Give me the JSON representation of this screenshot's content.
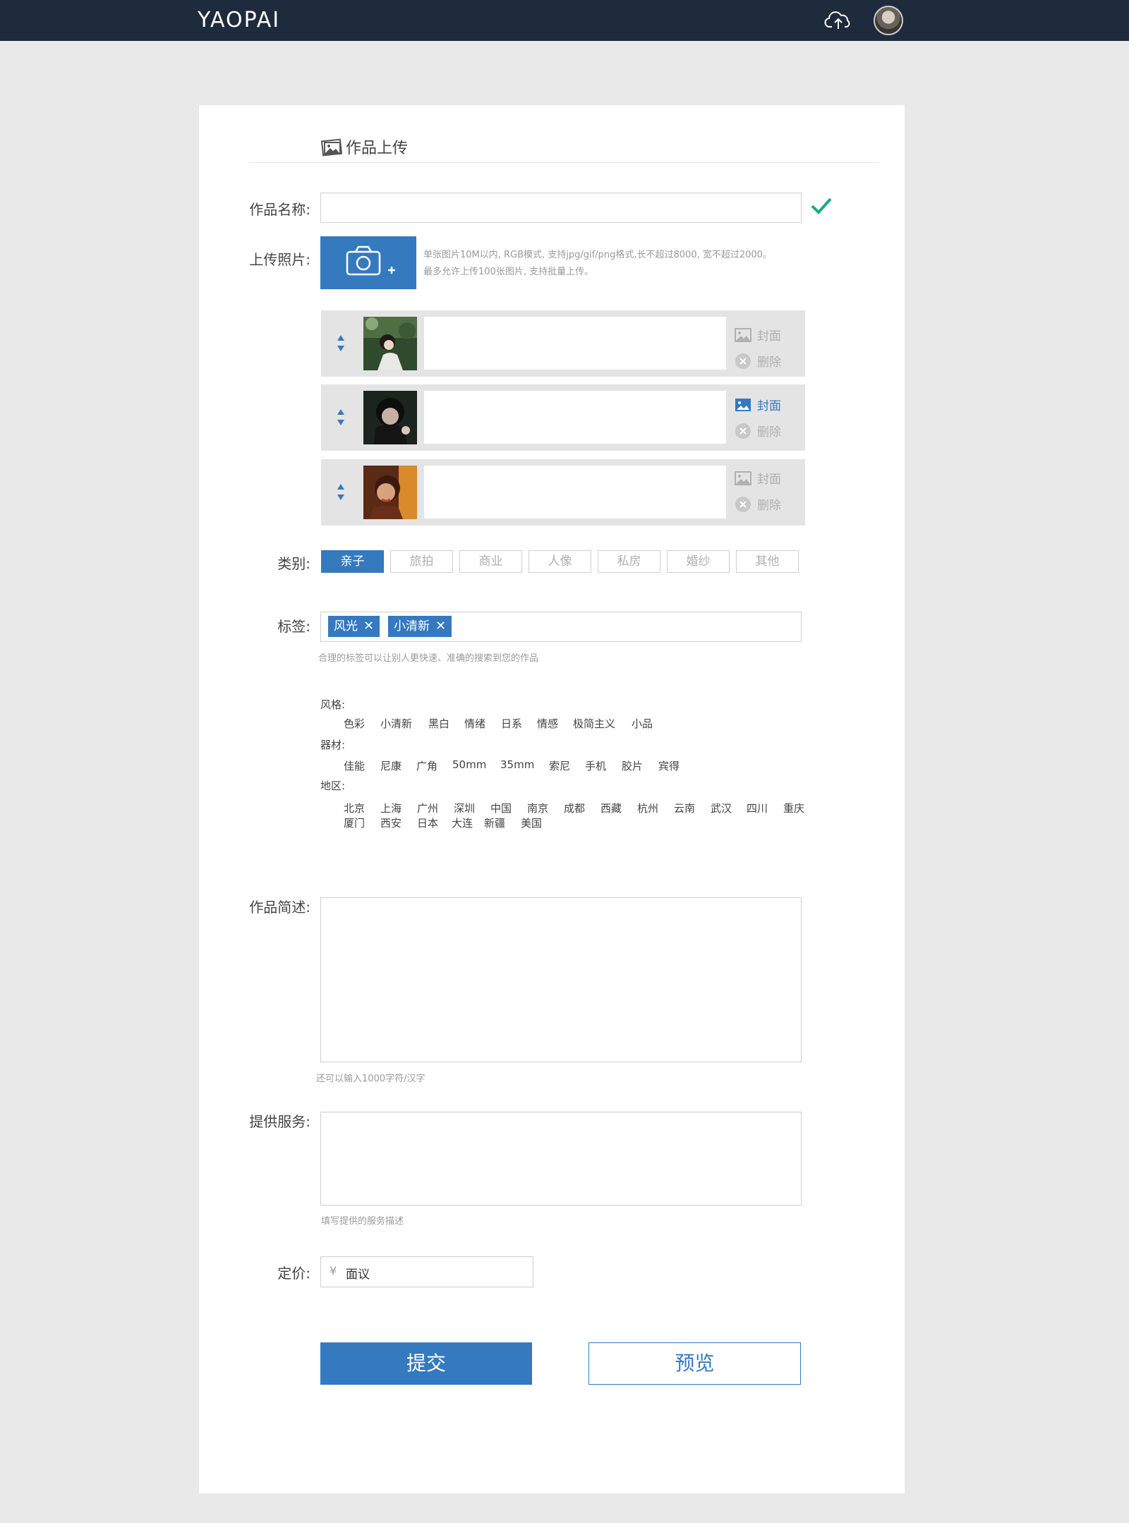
{
  "header": {
    "logo_text": "YAOPAI",
    "upload_icon": "cloud-upload-icon",
    "avatar_icon": "user-avatar"
  },
  "page": {
    "section_title": "作品上传"
  },
  "form": {
    "name_label": "作品名称:",
    "name_value": "",
    "photo_label": "上传照片:",
    "photo_hint_line1": "单张图片10M以内, RGB模式, 支持jpg/gif/png格式,长不超过8000, 宽不超过2000。",
    "photo_hint_line2": "最多允许上传100张图片, 支持批量上传。",
    "photos": [
      {
        "caption": "",
        "cover_label": "封面",
        "delete_label": "删除",
        "is_cover": false
      },
      {
        "caption": "",
        "cover_label": "封面",
        "delete_label": "删除",
        "is_cover": true
      },
      {
        "caption": "",
        "cover_label": "封面",
        "delete_label": "删除",
        "is_cover": false
      }
    ],
    "category_label": "类别:",
    "categories": [
      "亲子",
      "旅拍",
      "商业",
      "人像",
      "私房",
      "婚纱",
      "其他"
    ],
    "category_selected": "亲子",
    "tag_label": "标签:",
    "tags": [
      "风光",
      "小清新"
    ],
    "tag_hint": "合理的标签可以让别人更快速、准确的搜索到您的作品",
    "tag_groups": [
      {
        "name": "风格:",
        "rows": [
          [
            "色彩",
            "小清新",
            "黑白",
            "情绪",
            "日系",
            "情感",
            "极简主义",
            "小品"
          ]
        ]
      },
      {
        "name": "器材:",
        "rows": [
          [
            "佳能",
            "尼康",
            "广角",
            "50mm",
            "35mm",
            "索尼",
            "手机",
            "胶片",
            "宾得"
          ]
        ]
      },
      {
        "name": "地区:",
        "rows": [
          [
            "北京",
            "上海",
            "广州",
            "深圳",
            "中国",
            "南京",
            "成都",
            "西藏",
            "杭州",
            "云南",
            "武汉",
            "四川",
            "重庆"
          ],
          [
            "厦门",
            "西安",
            "日本",
            "大连",
            "新疆",
            "美国"
          ]
        ]
      }
    ],
    "desc_label": "作品简述:",
    "desc_hint": "还可以输入1000字符/汉字",
    "service_label": "提供服务:",
    "service_hint": "填写提供的服务描述",
    "price_label": "定价:",
    "price_symbol": "¥",
    "price_value": "面议",
    "submit_label": "提交",
    "preview_label": "预览"
  },
  "colors": {
    "primary": "#3579bf",
    "topbar": "#1e2b3c",
    "check": "#1aaa8a"
  }
}
